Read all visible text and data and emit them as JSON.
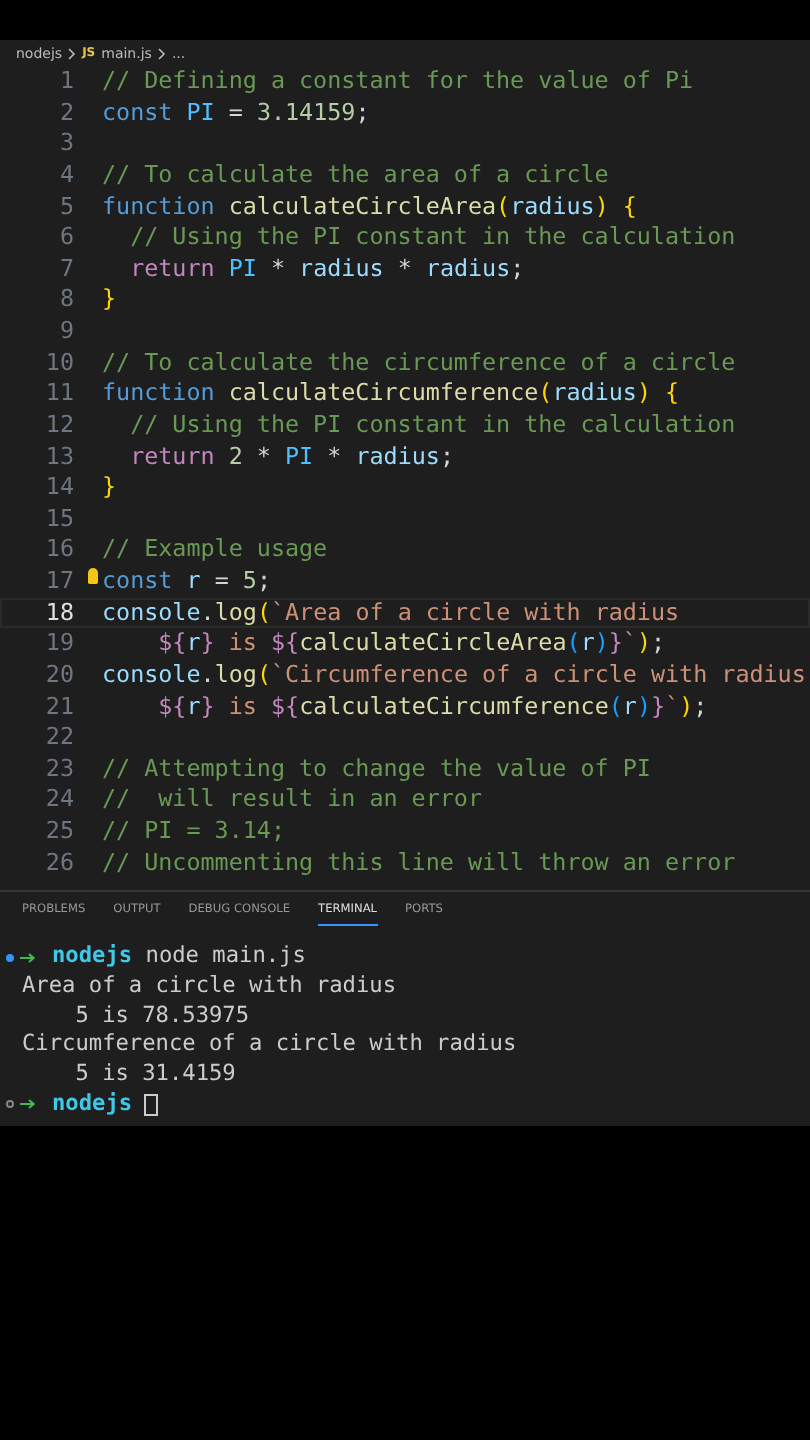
{
  "breadcrumb": {
    "folder": "nodejs",
    "file_badge": "JS",
    "file": "main.js",
    "tail": "..."
  },
  "code_lines": [
    {
      "number": "1",
      "active": false,
      "tokens": [
        {
          "kind": "comment",
          "text": "// Defining a constant for the value of Pi"
        }
      ]
    },
    {
      "number": "2",
      "active": false,
      "tokens": [
        {
          "kind": "keyword",
          "text": "const "
        },
        {
          "kind": "const",
          "text": "PI"
        },
        {
          "kind": "plain",
          "text": " = "
        },
        {
          "kind": "number",
          "text": "3.14159"
        },
        {
          "kind": "plain",
          "text": ";"
        }
      ]
    },
    {
      "number": "3",
      "active": false
    },
    {
      "number": "4",
      "active": false,
      "tokens": [
        {
          "kind": "comment",
          "text": "// To calculate the area of a circle"
        }
      ]
    },
    {
      "number": "5",
      "active": false,
      "tokens": [
        {
          "kind": "keyword",
          "text": "function "
        },
        {
          "kind": "function",
          "text": "calculateCircleArea"
        },
        {
          "kind": "bracket1",
          "text": "("
        },
        {
          "kind": "variable",
          "text": "radius"
        },
        {
          "kind": "bracket1",
          "text": ") {"
        }
      ]
    },
    {
      "number": "6",
      "active": false,
      "tokens": [
        {
          "kind": "comment",
          "text": "  // Using the PI constant in the calculation"
        }
      ]
    },
    {
      "number": "7",
      "active": false,
      "tokens": [
        {
          "kind": "control",
          "text": "  return "
        },
        {
          "kind": "const",
          "text": "PI"
        },
        {
          "kind": "plain",
          "text": " * "
        },
        {
          "kind": "variable",
          "text": "radius"
        },
        {
          "kind": "plain",
          "text": " * "
        },
        {
          "kind": "variable",
          "text": "radius"
        },
        {
          "kind": "plain",
          "text": ";"
        }
      ]
    },
    {
      "number": "8",
      "active": false,
      "tokens": [
        {
          "kind": "bracket1",
          "text": "}"
        }
      ]
    },
    {
      "number": "9",
      "active": false
    },
    {
      "number": "10",
      "active": false,
      "tokens": [
        {
          "kind": "comment",
          "text": "// To calculate the circumference of a circle"
        }
      ]
    },
    {
      "number": "11",
      "active": false,
      "tokens": [
        {
          "kind": "keyword",
          "text": "function "
        },
        {
          "kind": "function",
          "text": "calculateCircumference"
        },
        {
          "kind": "bracket1",
          "text": "("
        },
        {
          "kind": "variable",
          "text": "radius"
        },
        {
          "kind": "bracket1",
          "text": ") {"
        }
      ]
    },
    {
      "number": "12",
      "active": false,
      "tokens": [
        {
          "kind": "comment",
          "text": "  // Using the PI constant in the calculation"
        }
      ]
    },
    {
      "number": "13",
      "active": false,
      "tokens": [
        {
          "kind": "control",
          "text": "  return "
        },
        {
          "kind": "number",
          "text": "2"
        },
        {
          "kind": "plain",
          "text": " * "
        },
        {
          "kind": "const",
          "text": "PI"
        },
        {
          "kind": "plain",
          "text": " * "
        },
        {
          "kind": "variable",
          "text": "radius"
        },
        {
          "kind": "plain",
          "text": ";"
        }
      ]
    },
    {
      "number": "14",
      "active": false,
      "tokens": [
        {
          "kind": "bracket1",
          "text": "}"
        }
      ]
    },
    {
      "number": "15",
      "active": false
    },
    {
      "number": "16",
      "active": false,
      "tokens": [
        {
          "kind": "comment",
          "text": "// Example usage"
        }
      ]
    },
    {
      "number": "17",
      "active": false,
      "bulb": true,
      "tokens": [
        {
          "kind": "keyword",
          "text": "const "
        },
        {
          "kind": "variable",
          "text": "r"
        },
        {
          "kind": "plain",
          "text": " = "
        },
        {
          "kind": "number",
          "text": "5"
        },
        {
          "kind": "plain",
          "text": ";"
        }
      ]
    },
    {
      "number": "18",
      "active": true,
      "tokens": [
        {
          "kind": "variable",
          "text": "console"
        },
        {
          "kind": "plain",
          "text": "."
        },
        {
          "kind": "function",
          "text": "log"
        },
        {
          "kind": "bracket1",
          "text": "("
        },
        {
          "kind": "string",
          "text": "`Area of a circle with radius"
        }
      ]
    },
    {
      "number": "19",
      "active": false,
      "tokens": [
        {
          "kind": "control",
          "text": "    ${"
        },
        {
          "kind": "variable",
          "text": "r"
        },
        {
          "kind": "control",
          "text": "}"
        },
        {
          "kind": "string",
          "text": " is "
        },
        {
          "kind": "control",
          "text": "${"
        },
        {
          "kind": "function",
          "text": "calculateCircleArea"
        },
        {
          "kind": "bracket3",
          "text": "("
        },
        {
          "kind": "variable",
          "text": "r"
        },
        {
          "kind": "bracket3",
          "text": ")"
        },
        {
          "kind": "control",
          "text": "}"
        },
        {
          "kind": "string",
          "text": "`"
        },
        {
          "kind": "bracket1",
          "text": ")"
        },
        {
          "kind": "plain",
          "text": ";"
        }
      ]
    },
    {
      "number": "20",
      "active": false,
      "tokens": [
        {
          "kind": "variable",
          "text": "console"
        },
        {
          "kind": "plain",
          "text": "."
        },
        {
          "kind": "function",
          "text": "log"
        },
        {
          "kind": "bracket1",
          "text": "("
        },
        {
          "kind": "string",
          "text": "`Circumference of a circle with radius"
        }
      ]
    },
    {
      "number": "21",
      "active": false,
      "tokens": [
        {
          "kind": "control",
          "text": "    ${"
        },
        {
          "kind": "variable",
          "text": "r"
        },
        {
          "kind": "control",
          "text": "}"
        },
        {
          "kind": "string",
          "text": " is "
        },
        {
          "kind": "control",
          "text": "${"
        },
        {
          "kind": "function",
          "text": "calculateCircumference"
        },
        {
          "kind": "bracket3",
          "text": "("
        },
        {
          "kind": "variable",
          "text": "r"
        },
        {
          "kind": "bracket3",
          "text": ")"
        },
        {
          "kind": "control",
          "text": "}"
        },
        {
          "kind": "string",
          "text": "`"
        },
        {
          "kind": "bracket1",
          "text": ")"
        },
        {
          "kind": "plain",
          "text": ";"
        }
      ]
    },
    {
      "number": "22",
      "active": false
    },
    {
      "number": "23",
      "active": false,
      "tokens": [
        {
          "kind": "comment",
          "text": "// Attempting to change the value of PI"
        }
      ]
    },
    {
      "number": "24",
      "active": false,
      "tokens": [
        {
          "kind": "comment",
          "text": "//  will result in an error"
        }
      ]
    },
    {
      "number": "25",
      "active": false,
      "tokens": [
        {
          "kind": "comment",
          "text": "// PI = 3.14;"
        }
      ]
    },
    {
      "number": "26",
      "active": false,
      "tokens": [
        {
          "kind": "comment",
          "text": "// Uncommenting this line will throw an error"
        }
      ]
    }
  ],
  "panel_tabs": [
    {
      "label": "PROBLEMS",
      "selected": false
    },
    {
      "label": "OUTPUT",
      "selected": false
    },
    {
      "label": "DEBUG CONSOLE",
      "selected": false
    },
    {
      "label": "TERMINAL",
      "selected": true
    },
    {
      "label": "PORTS",
      "selected": false
    }
  ],
  "terminal_lines": [
    {
      "kind": "prompt",
      "finished": true,
      "dir": "nodejs",
      "command": "node main.js"
    },
    {
      "kind": "output",
      "text": "Area of a circle with radius"
    },
    {
      "kind": "output",
      "text": "    5 is 78.53975"
    },
    {
      "kind": "output",
      "text": "Circumference of a circle with radius"
    },
    {
      "kind": "output",
      "text": "    5 is 31.4159"
    },
    {
      "kind": "prompt",
      "finished": false,
      "dir": "nodejs"
    }
  ]
}
